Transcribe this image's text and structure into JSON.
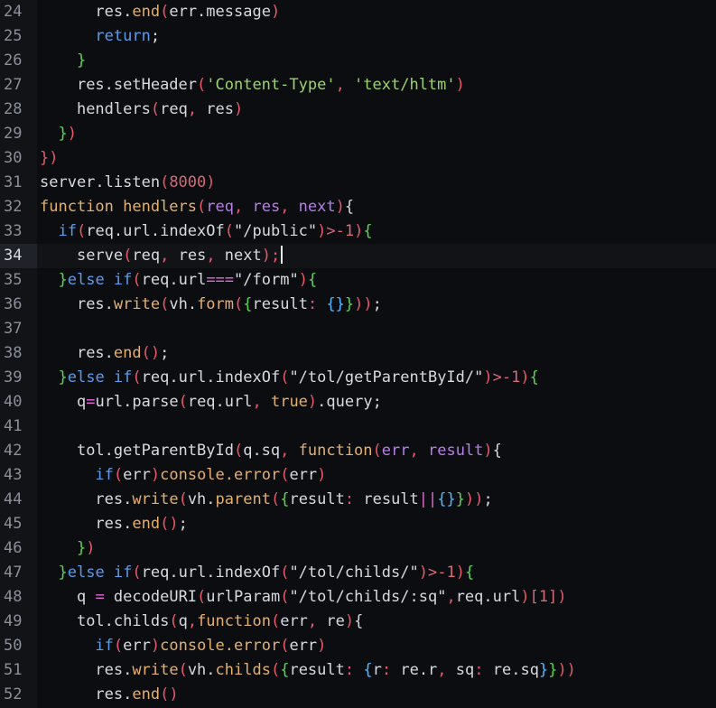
{
  "editor": {
    "current_line": 34,
    "colors": {
      "background": "#0b0d10",
      "gutter": "#111317",
      "line_number": "#8a8f99",
      "plain": "#d7dae0",
      "function": "#e3b070",
      "keyword": "#5d9be8",
      "string": "#9ed36a",
      "number": "#d46a7a",
      "punctuation": "#e85a6a",
      "bracket_green": "#5ed455",
      "bracket_blue": "#54b8ff",
      "operator": "#e06bd6",
      "param": "#b77ee8"
    },
    "lines": [
      {
        "n": 24,
        "indent": 6,
        "tokens": [
          [
            "res.",
            "plain"
          ],
          [
            "end",
            "fn"
          ],
          [
            "(",
            "punc"
          ],
          [
            "err.message",
            "plain"
          ],
          [
            ")",
            "punc"
          ]
        ]
      },
      {
        "n": 25,
        "indent": 6,
        "tokens": [
          [
            "return",
            "kw"
          ],
          [
            ";",
            "plain"
          ]
        ]
      },
      {
        "n": 26,
        "indent": 4,
        "tokens": [
          [
            "}",
            "brg"
          ]
        ]
      },
      {
        "n": 27,
        "indent": 4,
        "tokens": [
          [
            "res.setHeader",
            "plain"
          ],
          [
            "(",
            "punc"
          ],
          [
            "'Content-Type'",
            "str"
          ],
          [
            ", ",
            "punc"
          ],
          [
            "'text/hltm'",
            "str"
          ],
          [
            ")",
            "punc"
          ]
        ]
      },
      {
        "n": 28,
        "indent": 4,
        "tokens": [
          [
            "hendlers",
            "plain"
          ],
          [
            "(",
            "punc"
          ],
          [
            "req",
            "plain"
          ],
          [
            ", ",
            "punc"
          ],
          [
            "res",
            "plain"
          ],
          [
            ")",
            "punc"
          ]
        ]
      },
      {
        "n": 29,
        "indent": 2,
        "tokens": [
          [
            "}",
            "brg"
          ],
          [
            ")",
            "punc"
          ]
        ]
      },
      {
        "n": 30,
        "indent": 0,
        "tokens": [
          [
            "})",
            "punc"
          ]
        ]
      },
      {
        "n": 31,
        "indent": 0,
        "tokens": [
          [
            "server.listen",
            "plain"
          ],
          [
            "(",
            "punc"
          ],
          [
            "8000",
            "num"
          ],
          [
            ")",
            "punc"
          ]
        ]
      },
      {
        "n": 32,
        "indent": 0,
        "tokens": [
          [
            "function ",
            "fn"
          ],
          [
            "hendlers",
            "fn"
          ],
          [
            "(",
            "punc"
          ],
          [
            "req",
            "param"
          ],
          [
            ", ",
            "punc"
          ],
          [
            "res",
            "param"
          ],
          [
            ", ",
            "punc"
          ],
          [
            "next",
            "param"
          ],
          [
            ")",
            "punc"
          ],
          [
            "{",
            "plain"
          ]
        ]
      },
      {
        "n": 33,
        "indent": 2,
        "tokens": [
          [
            "if",
            "kw"
          ],
          [
            "(",
            "punc"
          ],
          [
            "req.url.indexOf",
            "plain"
          ],
          [
            "(",
            "punc"
          ],
          [
            "\"/public\"",
            "plain"
          ],
          [
            ")",
            "punc"
          ],
          [
            ">-1",
            "num"
          ],
          [
            ")",
            "punc"
          ],
          [
            "{",
            "brg"
          ]
        ]
      },
      {
        "n": 34,
        "indent": 4,
        "cursor": true,
        "tokens": [
          [
            "serve",
            "plain"
          ],
          [
            "(",
            "punc"
          ],
          [
            "req",
            "plain"
          ],
          [
            ", ",
            "punc"
          ],
          [
            "res",
            "plain"
          ],
          [
            ", ",
            "punc"
          ],
          [
            "next",
            "plain"
          ],
          [
            ");",
            "punc"
          ]
        ]
      },
      {
        "n": 35,
        "indent": 2,
        "tokens": [
          [
            "}",
            "brg"
          ],
          [
            "else ",
            "kw"
          ],
          [
            "if",
            "kw"
          ],
          [
            "(",
            "punc"
          ],
          [
            "req.url",
            "plain"
          ],
          [
            "===",
            "op"
          ],
          [
            "\"/form\"",
            "plain"
          ],
          [
            ")",
            "punc"
          ],
          [
            "{",
            "brg"
          ]
        ]
      },
      {
        "n": 36,
        "indent": 4,
        "tokens": [
          [
            "res.",
            "plain"
          ],
          [
            "write",
            "fn"
          ],
          [
            "(",
            "punc"
          ],
          [
            "vh.",
            "plain"
          ],
          [
            "form",
            "fn"
          ],
          [
            "(",
            "punc"
          ],
          [
            "{",
            "brg"
          ],
          [
            "result",
            "plain"
          ],
          [
            ": ",
            "punc"
          ],
          [
            "{}",
            "brb"
          ],
          [
            "}",
            "brg"
          ],
          [
            "))",
            "punc"
          ],
          [
            ";",
            "plain"
          ]
        ]
      },
      {
        "n": 37,
        "indent": 0,
        "tokens": []
      },
      {
        "n": 38,
        "indent": 4,
        "tokens": [
          [
            "res.",
            "plain"
          ],
          [
            "end",
            "fn"
          ],
          [
            "()",
            "punc"
          ],
          [
            ";",
            "plain"
          ]
        ]
      },
      {
        "n": 39,
        "indent": 2,
        "tokens": [
          [
            "}",
            "brg"
          ],
          [
            "else ",
            "kw"
          ],
          [
            "if",
            "kw"
          ],
          [
            "(",
            "punc"
          ],
          [
            "req.url.indexOf",
            "plain"
          ],
          [
            "(",
            "punc"
          ],
          [
            "\"/tol/getParentById/\"",
            "plain"
          ],
          [
            ")",
            "punc"
          ],
          [
            ">-1",
            "num"
          ],
          [
            ")",
            "punc"
          ],
          [
            "{",
            "brg"
          ]
        ]
      },
      {
        "n": 40,
        "indent": 4,
        "tokens": [
          [
            "q",
            "plain"
          ],
          [
            "=",
            "op"
          ],
          [
            "url.parse",
            "plain"
          ],
          [
            "(",
            "punc"
          ],
          [
            "req.url",
            "plain"
          ],
          [
            ", ",
            "punc"
          ],
          [
            "true",
            "fn"
          ],
          [
            ")",
            "punc"
          ],
          [
            ".query;",
            "plain"
          ]
        ]
      },
      {
        "n": 41,
        "indent": 0,
        "tokens": []
      },
      {
        "n": 42,
        "indent": 4,
        "tokens": [
          [
            "tol.getParentById",
            "plain"
          ],
          [
            "(",
            "punc"
          ],
          [
            "q.sq",
            "plain"
          ],
          [
            ", ",
            "punc"
          ],
          [
            "function",
            "fn"
          ],
          [
            "(",
            "punc"
          ],
          [
            "err",
            "param"
          ],
          [
            ", ",
            "punc"
          ],
          [
            "result",
            "param"
          ],
          [
            ")",
            "punc"
          ],
          [
            "{",
            "plain"
          ]
        ]
      },
      {
        "n": 43,
        "indent": 6,
        "tokens": [
          [
            "if",
            "kw"
          ],
          [
            "(",
            "punc"
          ],
          [
            "err",
            "plain"
          ],
          [
            ")",
            "punc"
          ],
          [
            "console.",
            "fn"
          ],
          [
            "error",
            "fn"
          ],
          [
            "(",
            "punc"
          ],
          [
            "err",
            "plain"
          ],
          [
            ")",
            "punc"
          ]
        ]
      },
      {
        "n": 44,
        "indent": 6,
        "tokens": [
          [
            "res.",
            "plain"
          ],
          [
            "write",
            "fn"
          ],
          [
            "(",
            "punc"
          ],
          [
            "vh.",
            "plain"
          ],
          [
            "parent",
            "fn"
          ],
          [
            "(",
            "punc"
          ],
          [
            "{",
            "brg"
          ],
          [
            "result",
            "plain"
          ],
          [
            ": ",
            "punc"
          ],
          [
            "result",
            "plain"
          ],
          [
            "||",
            "op"
          ],
          [
            "{}",
            "brb"
          ],
          [
            "}",
            "brg"
          ],
          [
            "))",
            "punc"
          ],
          [
            ";",
            "plain"
          ]
        ]
      },
      {
        "n": 45,
        "indent": 6,
        "tokens": [
          [
            "res.",
            "plain"
          ],
          [
            "end",
            "fn"
          ],
          [
            "()",
            "punc"
          ],
          [
            ";",
            "plain"
          ]
        ]
      },
      {
        "n": 46,
        "indent": 4,
        "tokens": [
          [
            "}",
            "brg"
          ],
          [
            ")",
            "punc"
          ]
        ]
      },
      {
        "n": 47,
        "indent": 2,
        "tokens": [
          [
            "}",
            "brg"
          ],
          [
            "else ",
            "kw"
          ],
          [
            "if",
            "kw"
          ],
          [
            "(",
            "punc"
          ],
          [
            "req.url.indexOf",
            "plain"
          ],
          [
            "(",
            "punc"
          ],
          [
            "\"/tol/childs/\"",
            "plain"
          ],
          [
            ")",
            "punc"
          ],
          [
            ">-1",
            "num"
          ],
          [
            ")",
            "punc"
          ],
          [
            "{",
            "brg"
          ]
        ]
      },
      {
        "n": 48,
        "indent": 4,
        "tokens": [
          [
            "q ",
            "plain"
          ],
          [
            "=",
            "op"
          ],
          [
            " decodeURI",
            "plain"
          ],
          [
            "(",
            "punc"
          ],
          [
            "urlParam",
            "plain"
          ],
          [
            "(",
            "punc"
          ],
          [
            "\"/tol/childs/:sq\"",
            "plain"
          ],
          [
            ",",
            "punc"
          ],
          [
            "req.url",
            "plain"
          ],
          [
            ")",
            "punc"
          ],
          [
            "[1]",
            "num"
          ],
          [
            ")",
            "punc"
          ]
        ]
      },
      {
        "n": 49,
        "indent": 4,
        "tokens": [
          [
            "tol.childs",
            "plain"
          ],
          [
            "(",
            "punc"
          ],
          [
            "q",
            "plain"
          ],
          [
            ",",
            "punc"
          ],
          [
            "function",
            "fn"
          ],
          [
            "(",
            "punc"
          ],
          [
            "err",
            "plain"
          ],
          [
            ", ",
            "punc"
          ],
          [
            "re",
            "plain"
          ],
          [
            ")",
            "punc"
          ],
          [
            "{",
            "plain"
          ]
        ]
      },
      {
        "n": 50,
        "indent": 6,
        "tokens": [
          [
            "if",
            "kw"
          ],
          [
            "(",
            "punc"
          ],
          [
            "err",
            "plain"
          ],
          [
            ")",
            "punc"
          ],
          [
            "console.",
            "fn"
          ],
          [
            "error",
            "fn"
          ],
          [
            "(",
            "punc"
          ],
          [
            "err",
            "plain"
          ],
          [
            ")",
            "punc"
          ]
        ]
      },
      {
        "n": 51,
        "indent": 6,
        "tokens": [
          [
            "res.",
            "plain"
          ],
          [
            "write",
            "fn"
          ],
          [
            "(",
            "punc"
          ],
          [
            "vh.",
            "plain"
          ],
          [
            "childs",
            "fn"
          ],
          [
            "(",
            "punc"
          ],
          [
            "{",
            "brg"
          ],
          [
            "result",
            "plain"
          ],
          [
            ": ",
            "punc"
          ],
          [
            "{",
            "brb"
          ],
          [
            "r",
            "plain"
          ],
          [
            ": ",
            "punc"
          ],
          [
            "re.r",
            "plain"
          ],
          [
            ", ",
            "punc"
          ],
          [
            "sq",
            "plain"
          ],
          [
            ": ",
            "punc"
          ],
          [
            "re.sq",
            "plain"
          ],
          [
            "}",
            "brb"
          ],
          [
            "}",
            "brg"
          ],
          [
            "))",
            "punc"
          ]
        ]
      },
      {
        "n": 52,
        "indent": 6,
        "tokens": [
          [
            "res.",
            "plain"
          ],
          [
            "end",
            "fn"
          ],
          [
            "()",
            "punc"
          ]
        ]
      }
    ]
  }
}
